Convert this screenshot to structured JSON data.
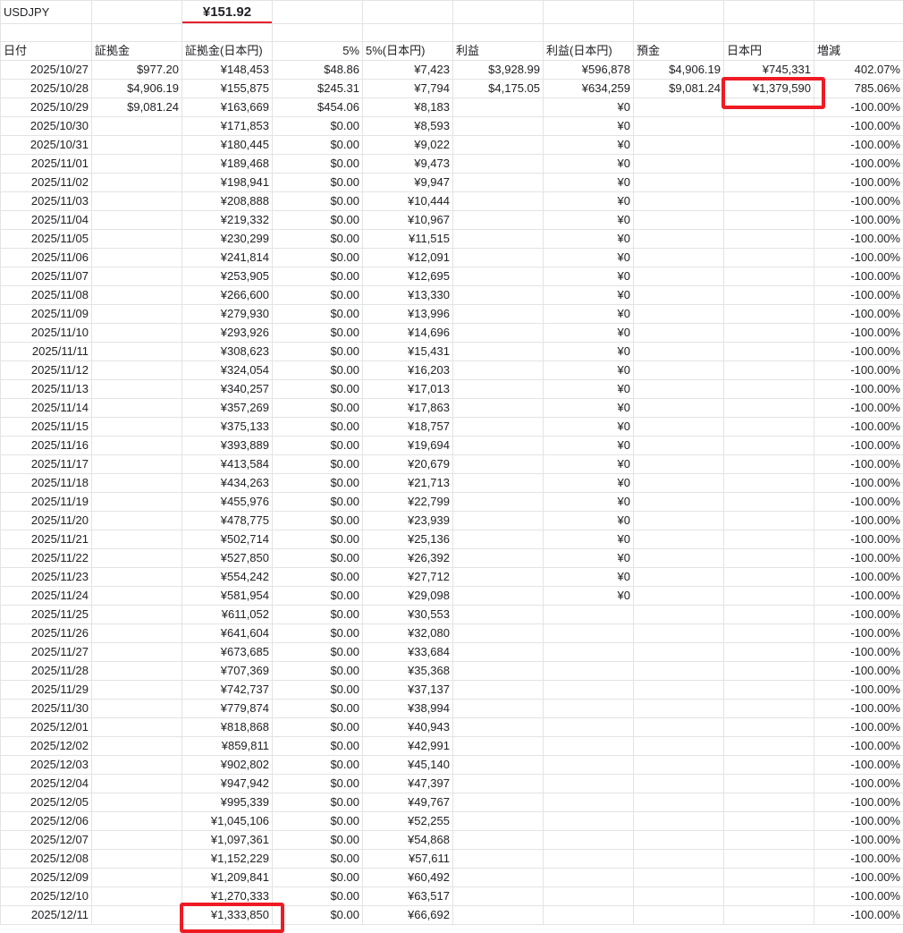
{
  "sheet": {
    "rate_label": "USDJPY",
    "rate_value": "¥151.92",
    "headers": [
      "日付",
      "証拠金",
      "証拠金(日本円)",
      "5%",
      "5%(日本円)",
      "利益",
      "利益(日本円)",
      "預金",
      "日本円",
      "増減"
    ],
    "rows": [
      [
        "2025/10/27",
        "$977.20",
        "¥148,453",
        "$48.86",
        "¥7,423",
        "$3,928.99",
        "¥596,878",
        "$4,906.19",
        "¥745,331",
        "402.07%"
      ],
      [
        "2025/10/28",
        "$4,906.19",
        "¥155,875",
        "$245.31",
        "¥7,794",
        "$4,175.05",
        "¥634,259",
        "$9,081.24",
        "¥1,379,590",
        "785.06%"
      ],
      [
        "2025/10/29",
        "$9,081.24",
        "¥163,669",
        "$454.06",
        "¥8,183",
        "",
        "¥0",
        "",
        "",
        "-100.00%"
      ],
      [
        "2025/10/30",
        "",
        "¥171,853",
        "$0.00",
        "¥8,593",
        "",
        "¥0",
        "",
        "",
        "-100.00%"
      ],
      [
        "2025/10/31",
        "",
        "¥180,445",
        "$0.00",
        "¥9,022",
        "",
        "¥0",
        "",
        "",
        "-100.00%"
      ],
      [
        "2025/11/01",
        "",
        "¥189,468",
        "$0.00",
        "¥9,473",
        "",
        "¥0",
        "",
        "",
        "-100.00%"
      ],
      [
        "2025/11/02",
        "",
        "¥198,941",
        "$0.00",
        "¥9,947",
        "",
        "¥0",
        "",
        "",
        "-100.00%"
      ],
      [
        "2025/11/03",
        "",
        "¥208,888",
        "$0.00",
        "¥10,444",
        "",
        "¥0",
        "",
        "",
        "-100.00%"
      ],
      [
        "2025/11/04",
        "",
        "¥219,332",
        "$0.00",
        "¥10,967",
        "",
        "¥0",
        "",
        "",
        "-100.00%"
      ],
      [
        "2025/11/05",
        "",
        "¥230,299",
        "$0.00",
        "¥11,515",
        "",
        "¥0",
        "",
        "",
        "-100.00%"
      ],
      [
        "2025/11/06",
        "",
        "¥241,814",
        "$0.00",
        "¥12,091",
        "",
        "¥0",
        "",
        "",
        "-100.00%"
      ],
      [
        "2025/11/07",
        "",
        "¥253,905",
        "$0.00",
        "¥12,695",
        "",
        "¥0",
        "",
        "",
        "-100.00%"
      ],
      [
        "2025/11/08",
        "",
        "¥266,600",
        "$0.00",
        "¥13,330",
        "",
        "¥0",
        "",
        "",
        "-100.00%"
      ],
      [
        "2025/11/09",
        "",
        "¥279,930",
        "$0.00",
        "¥13,996",
        "",
        "¥0",
        "",
        "",
        "-100.00%"
      ],
      [
        "2025/11/10",
        "",
        "¥293,926",
        "$0.00",
        "¥14,696",
        "",
        "¥0",
        "",
        "",
        "-100.00%"
      ],
      [
        "2025/11/11",
        "",
        "¥308,623",
        "$0.00",
        "¥15,431",
        "",
        "¥0",
        "",
        "",
        "-100.00%"
      ],
      [
        "2025/11/12",
        "",
        "¥324,054",
        "$0.00",
        "¥16,203",
        "",
        "¥0",
        "",
        "",
        "-100.00%"
      ],
      [
        "2025/11/13",
        "",
        "¥340,257",
        "$0.00",
        "¥17,013",
        "",
        "¥0",
        "",
        "",
        "-100.00%"
      ],
      [
        "2025/11/14",
        "",
        "¥357,269",
        "$0.00",
        "¥17,863",
        "",
        "¥0",
        "",
        "",
        "-100.00%"
      ],
      [
        "2025/11/15",
        "",
        "¥375,133",
        "$0.00",
        "¥18,757",
        "",
        "¥0",
        "",
        "",
        "-100.00%"
      ],
      [
        "2025/11/16",
        "",
        "¥393,889",
        "$0.00",
        "¥19,694",
        "",
        "¥0",
        "",
        "",
        "-100.00%"
      ],
      [
        "2025/11/17",
        "",
        "¥413,584",
        "$0.00",
        "¥20,679",
        "",
        "¥0",
        "",
        "",
        "-100.00%"
      ],
      [
        "2025/11/18",
        "",
        "¥434,263",
        "$0.00",
        "¥21,713",
        "",
        "¥0",
        "",
        "",
        "-100.00%"
      ],
      [
        "2025/11/19",
        "",
        "¥455,976",
        "$0.00",
        "¥22,799",
        "",
        "¥0",
        "",
        "",
        "-100.00%"
      ],
      [
        "2025/11/20",
        "",
        "¥478,775",
        "$0.00",
        "¥23,939",
        "",
        "¥0",
        "",
        "",
        "-100.00%"
      ],
      [
        "2025/11/21",
        "",
        "¥502,714",
        "$0.00",
        "¥25,136",
        "",
        "¥0",
        "",
        "",
        "-100.00%"
      ],
      [
        "2025/11/22",
        "",
        "¥527,850",
        "$0.00",
        "¥26,392",
        "",
        "¥0",
        "",
        "",
        "-100.00%"
      ],
      [
        "2025/11/23",
        "",
        "¥554,242",
        "$0.00",
        "¥27,712",
        "",
        "¥0",
        "",
        "",
        "-100.00%"
      ],
      [
        "2025/11/24",
        "",
        "¥581,954",
        "$0.00",
        "¥29,098",
        "",
        "¥0",
        "",
        "",
        "-100.00%"
      ],
      [
        "2025/11/25",
        "",
        "¥611,052",
        "$0.00",
        "¥30,553",
        "",
        "",
        "",
        "",
        "-100.00%"
      ],
      [
        "2025/11/26",
        "",
        "¥641,604",
        "$0.00",
        "¥32,080",
        "",
        "",
        "",
        "",
        "-100.00%"
      ],
      [
        "2025/11/27",
        "",
        "¥673,685",
        "$0.00",
        "¥33,684",
        "",
        "",
        "",
        "",
        "-100.00%"
      ],
      [
        "2025/11/28",
        "",
        "¥707,369",
        "$0.00",
        "¥35,368",
        "",
        "",
        "",
        "",
        "-100.00%"
      ],
      [
        "2025/11/29",
        "",
        "¥742,737",
        "$0.00",
        "¥37,137",
        "",
        "",
        "",
        "",
        "-100.00%"
      ],
      [
        "2025/11/30",
        "",
        "¥779,874",
        "$0.00",
        "¥38,994",
        "",
        "",
        "",
        "",
        "-100.00%"
      ],
      [
        "2025/12/01",
        "",
        "¥818,868",
        "$0.00",
        "¥40,943",
        "",
        "",
        "",
        "",
        "-100.00%"
      ],
      [
        "2025/12/02",
        "",
        "¥859,811",
        "$0.00",
        "¥42,991",
        "",
        "",
        "",
        "",
        "-100.00%"
      ],
      [
        "2025/12/03",
        "",
        "¥902,802",
        "$0.00",
        "¥45,140",
        "",
        "",
        "",
        "",
        "-100.00%"
      ],
      [
        "2025/12/04",
        "",
        "¥947,942",
        "$0.00",
        "¥47,397",
        "",
        "",
        "",
        "",
        "-100.00%"
      ],
      [
        "2025/12/05",
        "",
        "¥995,339",
        "$0.00",
        "¥49,767",
        "",
        "",
        "",
        "",
        "-100.00%"
      ],
      [
        "2025/12/06",
        "",
        "¥1,045,106",
        "$0.00",
        "¥52,255",
        "",
        "",
        "",
        "",
        "-100.00%"
      ],
      [
        "2025/12/07",
        "",
        "¥1,097,361",
        "$0.00",
        "¥54,868",
        "",
        "",
        "",
        "",
        "-100.00%"
      ],
      [
        "2025/12/08",
        "",
        "¥1,152,229",
        "$0.00",
        "¥57,611",
        "",
        "",
        "",
        "",
        "-100.00%"
      ],
      [
        "2025/12/09",
        "",
        "¥1,209,841",
        "$0.00",
        "¥60,492",
        "",
        "",
        "",
        "",
        "-100.00%"
      ],
      [
        "2025/12/10",
        "",
        "¥1,270,333",
        "$0.00",
        "¥63,517",
        "",
        "",
        "",
        "",
        "-100.00%"
      ],
      [
        "2025/12/11",
        "",
        "¥1,333,850",
        "$0.00",
        "¥66,692",
        "",
        "",
        "",
        "",
        "-100.00%"
      ]
    ],
    "highlight_color": "#ee1b24",
    "accent_underline_color": "#e8202a"
  }
}
